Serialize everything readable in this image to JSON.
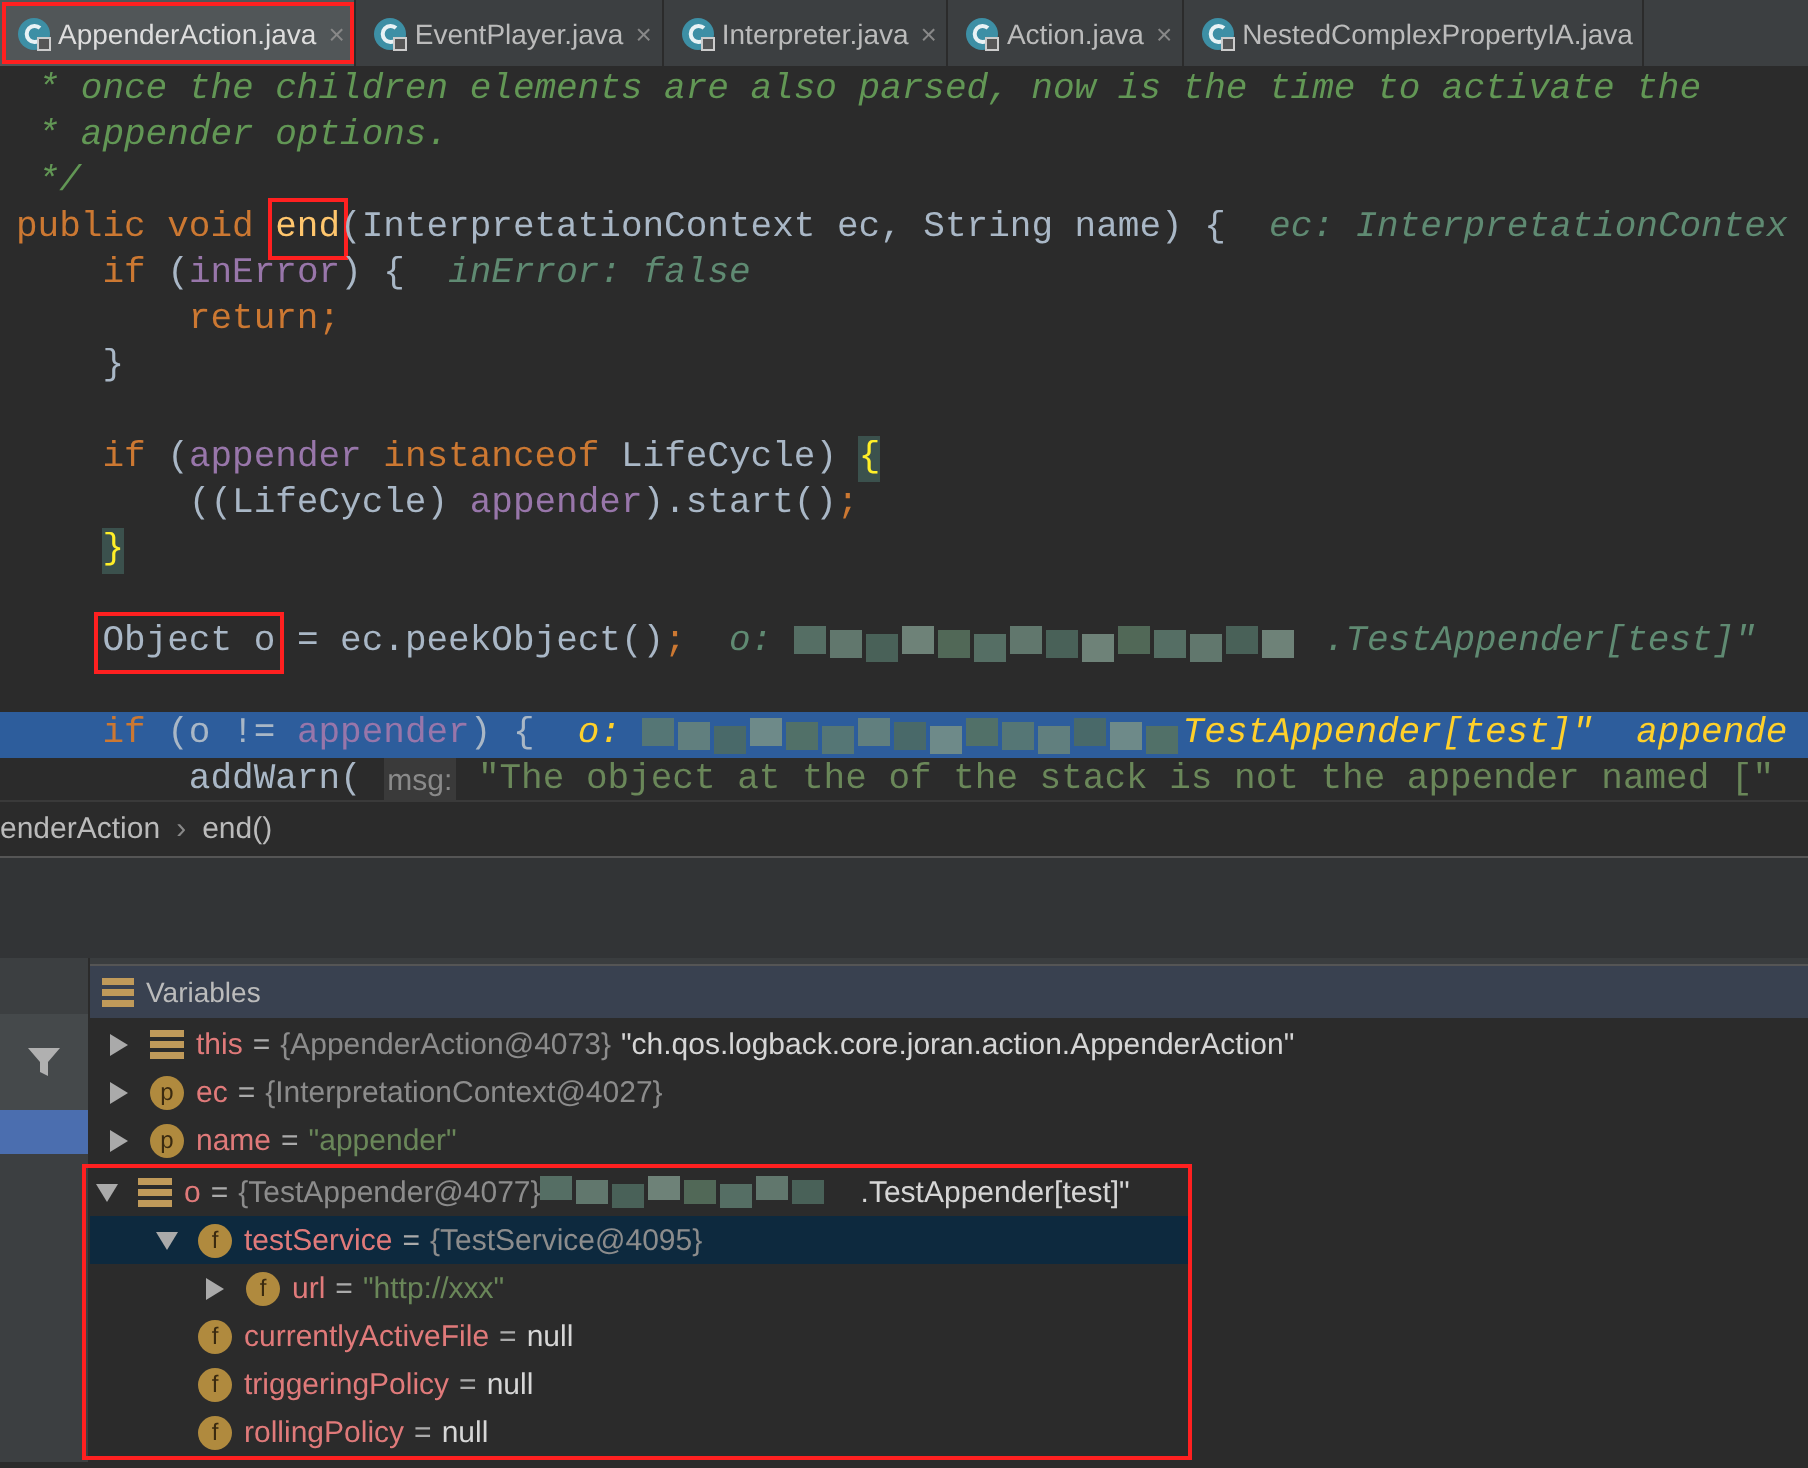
{
  "tabs": [
    {
      "label": "AppenderAction.java",
      "selected": true,
      "annotated": true,
      "close": "×"
    },
    {
      "label": "EventPlayer.java",
      "selected": false,
      "annotated": false,
      "close": "×"
    },
    {
      "label": "Interpreter.java",
      "selected": false,
      "annotated": false,
      "close": "×"
    },
    {
      "label": "Action.java",
      "selected": false,
      "annotated": false,
      "close": "×"
    },
    {
      "label": "NestedComplexPropertyIA.java",
      "selected": false,
      "annotated": false
    }
  ],
  "code_lines": [
    {
      "current": false,
      "tokens": [
        {
          "kind": "comment",
          "text": " * once the children elements are also parsed, now is the time to activate the"
        }
      ]
    },
    {
      "current": false,
      "tokens": [
        {
          "kind": "comment",
          "text": " * appender options."
        }
      ]
    },
    {
      "current": false,
      "tokens": [
        {
          "kind": "comment",
          "text": " */"
        }
      ]
    },
    {
      "current": false,
      "tokens": [
        {
          "kind": "keyword",
          "text": "public void "
        },
        {
          "kind": "method",
          "text": "end",
          "annotated": true
        },
        {
          "kind": "plain",
          "text": "(InterpretationContext ec, String name) {  "
        },
        {
          "kind": "hint",
          "text": "ec: InterpretationContex"
        }
      ]
    },
    {
      "current": false,
      "tokens": [
        {
          "kind": "keyword",
          "text": "    if "
        },
        {
          "kind": "plain",
          "text": "("
        },
        {
          "kind": "field",
          "text": "inError"
        },
        {
          "kind": "plain",
          "text": ") {  "
        },
        {
          "kind": "hint",
          "text": "inError: false"
        }
      ]
    },
    {
      "current": false,
      "tokens": [
        {
          "kind": "keyword",
          "text": "        return;"
        }
      ]
    },
    {
      "current": false,
      "tokens": [
        {
          "kind": "plain",
          "text": "    }"
        }
      ]
    },
    {
      "current": false
    },
    {
      "current": false,
      "tokens": [
        {
          "kind": "keyword",
          "text": "    if "
        },
        {
          "kind": "plain",
          "text": "("
        },
        {
          "kind": "field",
          "text": "appender"
        },
        {
          "kind": "keyword",
          "text": " instanceof "
        },
        {
          "kind": "plain",
          "text": "LifeCycle) "
        },
        {
          "kind": "brace",
          "text": "{"
        }
      ]
    },
    {
      "current": false,
      "tokens": [
        {
          "kind": "plain",
          "text": "        ((LifeCycle) "
        },
        {
          "kind": "field",
          "text": "appender"
        },
        {
          "kind": "plain",
          "text": ").start()"
        },
        {
          "kind": "keyword",
          "text": ";"
        }
      ]
    },
    {
      "current": false,
      "tokens": [
        {
          "kind": "brace",
          "text": "    }"
        }
      ]
    },
    {
      "current": false
    },
    {
      "current": false,
      "tokens": [
        {
          "kind": "plain",
          "text": "    Object o",
          "annotated": true
        },
        {
          "kind": "plain",
          "text": " = ec.peekObject()"
        },
        {
          "kind": "keyword",
          "text": ";  "
        },
        {
          "kind": "hint",
          "text": "o: "
        },
        {
          "kind": "blur"
        },
        {
          "kind": "hint",
          "text": ".TestAppender[test]\""
        }
      ]
    },
    {
      "current": false
    },
    {
      "current": true,
      "tokens": [
        {
          "kind": "keyword",
          "text": "    if "
        },
        {
          "kind": "plain",
          "text": "(o != "
        },
        {
          "kind": "field",
          "text": "appender"
        },
        {
          "kind": "plain",
          "text": ") {  "
        },
        {
          "kind": "hint",
          "text": "o: "
        },
        {
          "kind": "blur"
        },
        {
          "kind": "hint",
          "text": "TestAppender[test]\"  appende"
        }
      ]
    },
    {
      "current": false,
      "tokens": [
        {
          "kind": "plain",
          "text": "        addWarn( "
        },
        {
          "kind": "label",
          "text": "msg:"
        },
        {
          "kind": "string",
          "text": " \"The object at the of the stack is not the appender named [\""
        }
      ]
    }
  ],
  "breadcrumb": {
    "items": [
      "enderAction",
      "end()"
    ],
    "separator": "›"
  },
  "variables": {
    "title": "Variables",
    "nodes": [
      {
        "kind": "object",
        "name": "this",
        "equals": "=",
        "type": "{AppenderAction@4073}",
        "value": "\"ch.qos.logback.core.joran.action.AppenderAction\"",
        "is_string": false,
        "expanded": false,
        "selected": false
      },
      {
        "kind": "member",
        "badge": "p",
        "name": "ec",
        "equals": "=",
        "type": "{InterpretationContext@4027}",
        "expanded": false,
        "selected": false
      },
      {
        "kind": "member",
        "badge": "p",
        "name": "name",
        "equals": "=",
        "value": "\"appender\"",
        "is_string": true,
        "expanded": false,
        "selected": false
      },
      {
        "kind": "object",
        "name": "o",
        "equals": "=",
        "type": "{TestAppender@4077}",
        "redacted": true,
        "value": ".TestAppender[test]\"",
        "is_string": false,
        "expanded": true,
        "selected": false,
        "annotated": true,
        "children": [
          {
            "kind": "member",
            "badge": "f",
            "name": "testService",
            "equals": "=",
            "type": "{TestService@4095}",
            "expanded": true,
            "selected": true,
            "children": [
              {
                "kind": "member",
                "badge": "f",
                "name": "url",
                "equals": "=",
                "value": "\"http://xxx\"",
                "is_string": true,
                "expanded": false,
                "selected": false
              }
            ]
          },
          {
            "kind": "member",
            "badge": "f",
            "name": "currentlyActiveFile",
            "equals": "=",
            "value": "null",
            "is_string": false,
            "selected": false
          },
          {
            "kind": "member",
            "badge": "f",
            "name": "triggeringPolicy",
            "equals": "=",
            "value": "null",
            "is_string": false,
            "selected": false
          },
          {
            "kind": "member",
            "badge": "f",
            "name": "rollingPolicy",
            "equals": "=",
            "value": "null",
            "is_string": false,
            "selected": false
          }
        ]
      }
    ]
  }
}
